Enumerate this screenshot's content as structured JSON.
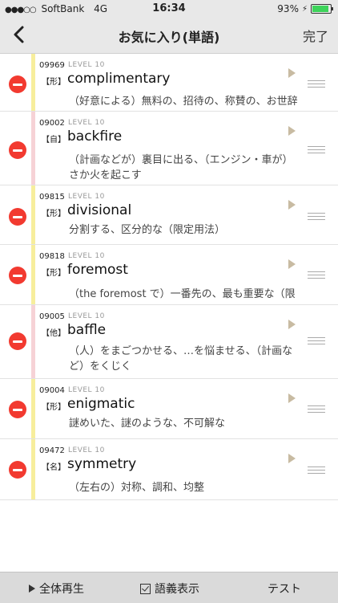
{
  "status": {
    "carrier": "SoftBank",
    "network": "4G",
    "time": "16:34",
    "battery_text": "93%",
    "battery_level": 0.93
  },
  "nav": {
    "back_icon": "chevron-left-icon",
    "title": "お気に入り(単語)",
    "done_label": "完了"
  },
  "colors": {
    "stripe_yellow": "#f7ee9c",
    "stripe_pink": "#f6d2d6",
    "delete_red": "#f23a30",
    "play_triangle": "#c8bba2"
  },
  "items": [
    {
      "number": "09969",
      "level": "LEVEL 10",
      "pos": "【形】",
      "word": "complimentary",
      "definition": "（好意による）無料の、招待の、称賛の、お世辞の",
      "stripe": "yellow"
    },
    {
      "number": "09002",
      "level": "LEVEL 10",
      "pos": "【自】",
      "word": "backfire",
      "definition": "（計画などが）裏目に出る、（エンジン・車が）さか火を起こす",
      "stripe": "pink"
    },
    {
      "number": "09815",
      "level": "LEVEL 10",
      "pos": "【形】",
      "word": "divisional",
      "definition": "分割する、区分的な（限定用法）",
      "stripe": "yellow"
    },
    {
      "number": "09818",
      "level": "LEVEL 10",
      "pos": "【形】",
      "word": "foremost",
      "definition": "（the foremost で）一番先の、最も重要な（限定用法）",
      "stripe": "yellow"
    },
    {
      "number": "09005",
      "level": "LEVEL 10",
      "pos": "【他】",
      "word": "baffle",
      "definition": "（人）をまごつかせる、…を悩ませる、（計画など）をくじく",
      "stripe": "pink"
    },
    {
      "number": "09004",
      "level": "LEVEL 10",
      "pos": "【形】",
      "word": "enigmatic",
      "definition": "謎めいた、謎のような、不可解な",
      "stripe": "yellow"
    },
    {
      "number": "09472",
      "level": "LEVEL 10",
      "pos": "【名】",
      "word": "symmetry",
      "definition": "（左右の）対称、調和、均整",
      "stripe": "yellow"
    }
  ],
  "toolbar": {
    "play_all_label": "全体再生",
    "show_meaning_label": "語義表示",
    "show_meaning_checked": true,
    "test_label": "テスト"
  }
}
